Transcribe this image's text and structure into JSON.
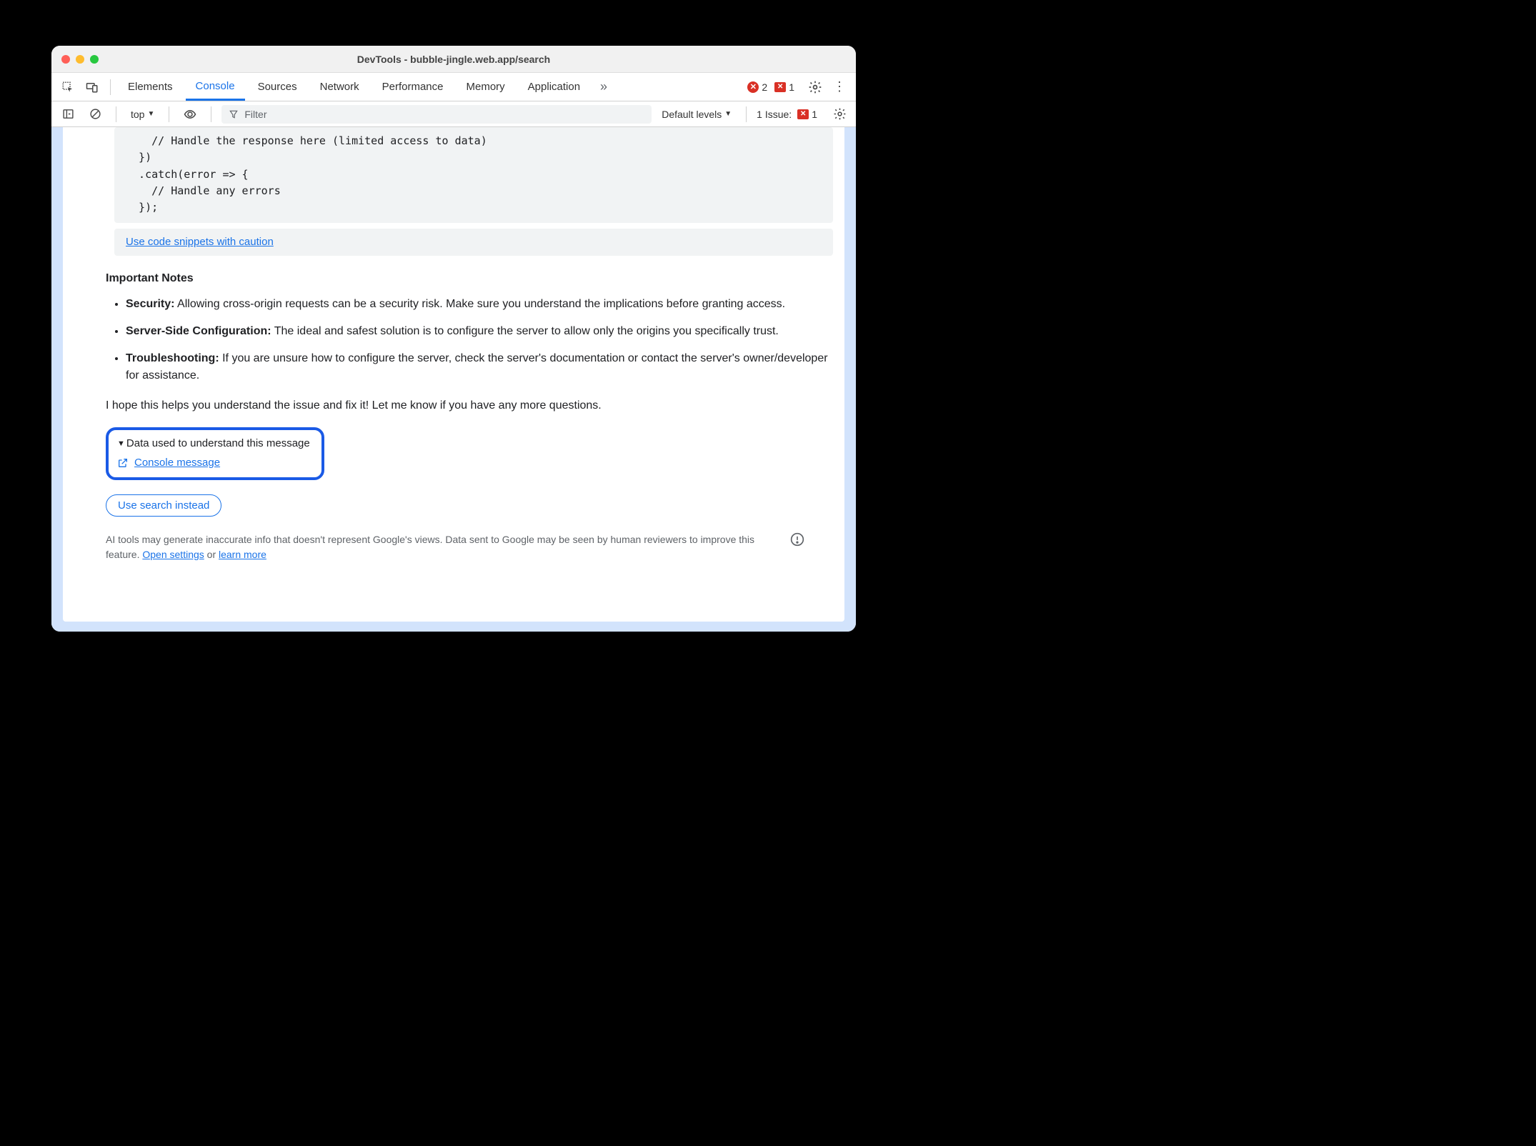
{
  "window": {
    "title": "DevTools - bubble-jingle.web.app/search"
  },
  "tabs": {
    "items": [
      "Elements",
      "Console",
      "Sources",
      "Network",
      "Performance",
      "Memory",
      "Application"
    ],
    "active": "Console",
    "error_count": "2",
    "issue_count": "1"
  },
  "console_toolbar": {
    "frame_dropdown": "top",
    "filter_placeholder": "Filter",
    "levels_label": "Default levels",
    "issues_label": "1 Issue:",
    "issues_count": "1"
  },
  "code": "    // Handle the response here (limited access to data)\n  })\n  .catch(error => {\n    // Handle any errors\n  });",
  "caution_link": "Use code snippets with caution",
  "notes": {
    "heading": "Important Notes",
    "items": [
      {
        "bold": "Security:",
        "text": " Allowing cross-origin requests can be a security risk. Make sure you understand the implications before granting access."
      },
      {
        "bold": "Server-Side Configuration:",
        "text": " The ideal and safest solution is to configure the server to allow only the origins you specifically trust."
      },
      {
        "bold": "Troubleshooting:",
        "text": " If you are unsure how to configure the server, check the server's documentation or contact the server's owner/developer for assistance."
      }
    ],
    "closing": "I hope this helps you understand the issue and fix it! Let me know if you have any more questions."
  },
  "data_used": {
    "summary": "Data used to understand this message",
    "link": "Console message"
  },
  "search_button": "Use search instead",
  "footer": {
    "text_1": "AI tools may generate inaccurate info that doesn't represent Google's views. Data sent to Google may be seen by human reviewers to improve this feature. ",
    "link_1": "Open settings",
    "text_2": " or ",
    "link_2": "learn more"
  }
}
